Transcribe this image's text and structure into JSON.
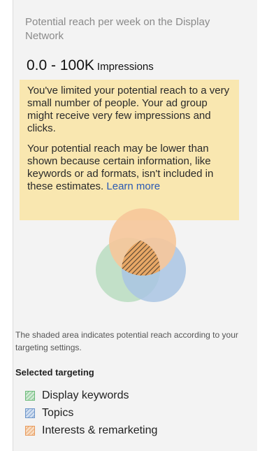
{
  "heading": "Potential reach per week on the Display Network",
  "reach": {
    "range": "0.0 - 100K",
    "unit": "Impressions"
  },
  "warning": {
    "paragraph1": "You've limited your potential reach to a very small number of people. Your ad group might receive very few impressions and clicks.",
    "paragraph2": "Your potential reach may be lower than shown because certain information, like keywords or ad formats, isn't included in these estimates.",
    "learn_more": "Learn more",
    "background": "#f9e7b0"
  },
  "venn": {
    "colors": {
      "interests": "#f6c79a",
      "keywords": "#b9dcc0",
      "topics": "#a9c4e3",
      "hatch": "#5a4632"
    }
  },
  "caption": "The shaded area indicates potential reach according to your targeting settings.",
  "selected_targeting": {
    "title": "Selected targeting",
    "items": [
      {
        "label": "Display keywords",
        "icon": "keywords-swatch-icon",
        "color": "#6dbb7a"
      },
      {
        "label": "Topics",
        "icon": "topics-swatch-icon",
        "color": "#6c95c9"
      },
      {
        "label": "Interests & remarketing",
        "icon": "interests-swatch-icon",
        "color": "#e89a5c"
      }
    ]
  }
}
